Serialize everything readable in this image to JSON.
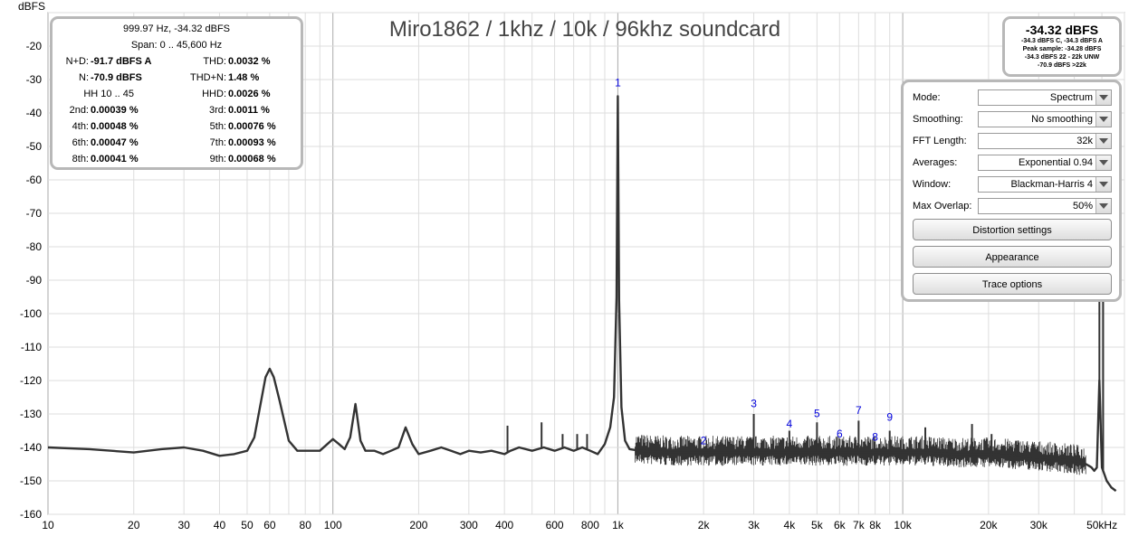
{
  "chart_data": {
    "type": "line",
    "title": "Miro1862 / 1khz / 10k / 96khz soundcard",
    "ylabel": "dBFS",
    "xlabel": "",
    "xscale": "log",
    "xlim": [
      10,
      60000
    ],
    "ylim": [
      -160,
      -10
    ],
    "grid": true,
    "y_ticks": [
      -20,
      -30,
      -40,
      -50,
      -60,
      -70,
      -80,
      -90,
      -100,
      -110,
      -120,
      -130,
      -140,
      -150,
      -160
    ],
    "x_ticks": [
      {
        "v": 10,
        "label": "10"
      },
      {
        "v": 20,
        "label": "20"
      },
      {
        "v": 30,
        "label": "30"
      },
      {
        "v": 40,
        "label": "40"
      },
      {
        "v": 50,
        "label": "50"
      },
      {
        "v": 60,
        "label": "60"
      },
      {
        "v": 80,
        "label": "80"
      },
      {
        "v": 100,
        "label": "100"
      },
      {
        "v": 200,
        "label": "200"
      },
      {
        "v": 300,
        "label": "300"
      },
      {
        "v": 400,
        "label": "400"
      },
      {
        "v": 600,
        "label": "600"
      },
      {
        "v": 800,
        "label": "800"
      },
      {
        "v": 1000,
        "label": "1k"
      },
      {
        "v": 2000,
        "label": "2k"
      },
      {
        "v": 3000,
        "label": "3k"
      },
      {
        "v": 4000,
        "label": "4k"
      },
      {
        "v": 5000,
        "label": "5k"
      },
      {
        "v": 6000,
        "label": "6k"
      },
      {
        "v": 7000,
        "label": "7k"
      },
      {
        "v": 8000,
        "label": "8k"
      },
      {
        "v": 10000,
        "label": "10k"
      },
      {
        "v": 20000,
        "label": "20k"
      },
      {
        "v": 30000,
        "label": "30k"
      },
      {
        "v": 50000,
        "label": "50kHz"
      }
    ],
    "series": [
      {
        "x": [
          10,
          14,
          20,
          25,
          30,
          35,
          40,
          45,
          50,
          53,
          56,
          58,
          60,
          62,
          65,
          70,
          75,
          80,
          90,
          100,
          105,
          110,
          115,
          120,
          125,
          130,
          140,
          150,
          160,
          170,
          180,
          190,
          200,
          220,
          240,
          260,
          280,
          300,
          330,
          360,
          400,
          420,
          450,
          500,
          550,
          600,
          650,
          700,
          750,
          800,
          850,
          900,
          940,
          970,
          990,
          1000,
          1010,
          1030,
          1060,
          1100,
          1200,
          1500,
          2000,
          2500,
          3000,
          3200,
          4000,
          5000,
          6000,
          7000,
          8000,
          9000,
          10000,
          12000,
          15000,
          18000,
          20000,
          25000,
          30000,
          35000,
          40000,
          43000,
          44000,
          45000,
          46000,
          47000,
          48000,
          49000,
          50000,
          51000,
          52000,
          53000,
          54000,
          56000
        ],
        "y": [
          -140,
          -140.5,
          -141.5,
          -140.5,
          -140,
          -141,
          -142.5,
          -142,
          -141,
          -137,
          -126,
          -119,
          -116.5,
          -119,
          -126,
          -138,
          -141,
          -141,
          -141,
          -137.5,
          -139,
          -140.5,
          -137,
          -127,
          -138,
          -141,
          -141,
          -142,
          -141,
          -140,
          -134,
          -139,
          -142,
          -141,
          -140,
          -141,
          -142,
          -141,
          -141.5,
          -141,
          -142,
          -141,
          -140,
          -141,
          -140,
          -141,
          -140,
          -141,
          -140,
          -141,
          -142,
          -139,
          -134,
          -125,
          -95,
          -35,
          -96,
          -128,
          -138,
          -140.5,
          -141,
          -141.5,
          -141.5,
          -141.5,
          -141.5,
          -141.5,
          -141.5,
          -141.5,
          -141.5,
          -141.5,
          -141.5,
          -141.5,
          -141.5,
          -141.5,
          -142,
          -142,
          -142,
          -142.5,
          -143,
          -143.5,
          -144,
          -144.5,
          -145,
          -145.5,
          -146,
          -147,
          -146,
          -120,
          -146,
          -148,
          -150,
          -151,
          -152,
          -153
        ]
      }
    ],
    "harmonic_markers": [
      {
        "label": "1",
        "x": 1000,
        "y": -32
      },
      {
        "label": "2",
        "x": 2000,
        "y": -139
      },
      {
        "label": "3",
        "x": 3000,
        "y": -128
      },
      {
        "label": "4",
        "x": 4000,
        "y": -134
      },
      {
        "label": "5",
        "x": 5000,
        "y": -131
      },
      {
        "label": "6",
        "x": 6000,
        "y": -137
      },
      {
        "label": "7",
        "x": 7000,
        "y": -130
      },
      {
        "label": "8",
        "x": 8000,
        "y": -138
      },
      {
        "label": "9",
        "x": 9000,
        "y": -132
      }
    ],
    "spurs": [
      {
        "x": 410,
        "y": -133.5
      },
      {
        "x": 540,
        "y": -132.5
      },
      {
        "x": 640,
        "y": -136
      },
      {
        "x": 720,
        "y": -136
      },
      {
        "x": 780,
        "y": -136
      },
      {
        "x": 3000,
        "y": -130
      },
      {
        "x": 4000,
        "y": -135
      },
      {
        "x": 5000,
        "y": -132.5
      },
      {
        "x": 7000,
        "y": -132
      },
      {
        "x": 9000,
        "y": -135
      },
      {
        "x": 12000,
        "y": -134
      },
      {
        "x": 17500,
        "y": -133
      },
      {
        "x": 20500,
        "y": -136
      },
      {
        "x": 25000,
        "y": -138
      },
      {
        "x": 49000,
        "y": -35
      },
      {
        "x": 50500,
        "y": -42
      }
    ],
    "colors": {
      "trace": "#333333",
      "marker": "#0000dd",
      "grid": "#dddddd",
      "grid_major": "#aaaaaa"
    }
  },
  "info_panel": {
    "cursor": "999.97 Hz, -34.32 dBFS",
    "span": "Span: 0 .. 45,600 Hz",
    "rows": [
      {
        "l1": "N+D:",
        "v1": "-91.7 dBFS A",
        "l2": "THD:",
        "v2": "0.0032 %"
      },
      {
        "l1": "N:",
        "v1": "-70.9 dBFS",
        "l2": "THD+N:",
        "v2": "1.48 %"
      },
      {
        "l1": "HH 10 .. 45",
        "v1": "",
        "l2": "HHD:",
        "v2": "0.0026 %"
      },
      {
        "l1": "2nd:",
        "v1": "0.00039 %",
        "l2": "3rd:",
        "v2": "0.0011 %"
      },
      {
        "l1": "4th:",
        "v1": "0.00048 %",
        "l2": "5th:",
        "v2": "0.00076 %"
      },
      {
        "l1": "6th:",
        "v1": "0.00047 %",
        "l2": "7th:",
        "v2": "0.00093 %"
      },
      {
        "l1": "8th:",
        "v1": "0.00041 %",
        "l2": "9th:",
        "v2": "0.00068 %"
      }
    ]
  },
  "level_panel": {
    "level": "-34.32 dBFS",
    "line1": "-34.3 dBFS C, -34.3 dBFS A",
    "line2": "Peak sample: -34.28 dBFS",
    "line3": "-34.3 dBFS 22 - 22k UNW",
    "line4": "-70.9 dBFS >22k"
  },
  "controls": {
    "rows": [
      {
        "label": "Mode:",
        "value": "Spectrum"
      },
      {
        "label": "Smoothing:",
        "value": "No  smoothing"
      },
      {
        "label": "FFT Length:",
        "value": "32k"
      },
      {
        "label": "Averages:",
        "value": "Exponential 0.94"
      },
      {
        "label": "Window:",
        "value": "Blackman-Harris 4"
      },
      {
        "label": "Max Overlap:",
        "value": "50%"
      }
    ],
    "buttons": [
      "Distortion settings",
      "Appearance",
      "Trace options"
    ]
  }
}
